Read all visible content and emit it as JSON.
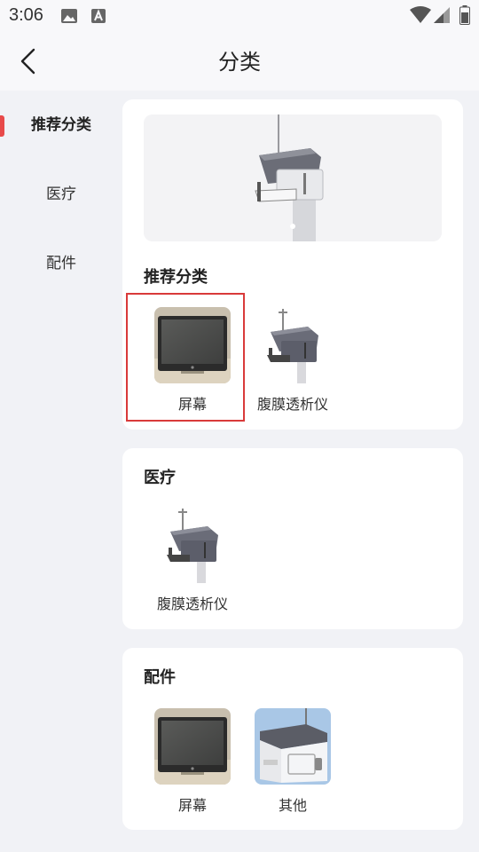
{
  "status_bar": {
    "time": "3:06",
    "icons": [
      "image-icon",
      "font-a-icon",
      "wifi-icon",
      "signal-icon",
      "battery-icon"
    ]
  },
  "nav": {
    "title": "分类",
    "back_icon": "chevron-left-icon"
  },
  "sidebar": {
    "active_index": 0,
    "items": [
      {
        "label": "推荐分类"
      },
      {
        "label": "医疗"
      },
      {
        "label": "配件"
      }
    ]
  },
  "sections": [
    {
      "title": "推荐分类",
      "items": [
        {
          "label": "屏幕",
          "image": "monitor-screen"
        },
        {
          "label": "腹膜透析仪",
          "image": "dialysis-machine"
        }
      ]
    },
    {
      "title": "医疗",
      "items": [
        {
          "label": "腹膜透析仪",
          "image": "dialysis-machine"
        }
      ]
    },
    {
      "title": "配件",
      "items": [
        {
          "label": "屏幕",
          "image": "monitor-screen"
        },
        {
          "label": "其他",
          "image": "device-other"
        }
      ]
    }
  ],
  "colors": {
    "accent": "#e84a4a",
    "page_bg": "#f1f2f6",
    "card_bg": "#ffffff"
  }
}
